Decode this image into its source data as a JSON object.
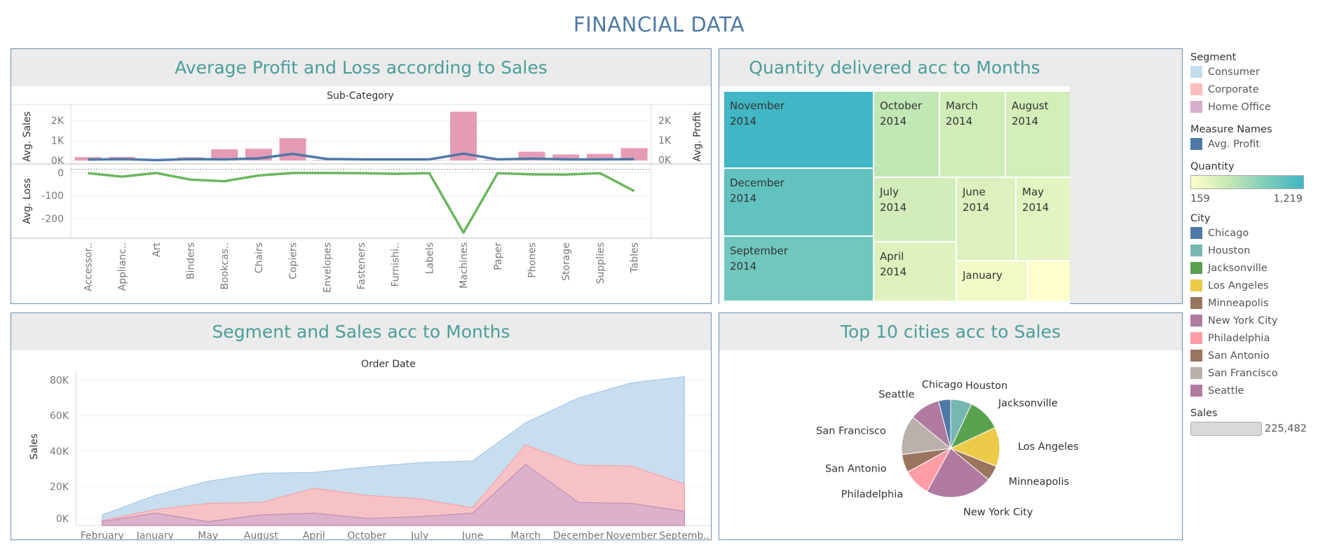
{
  "title": "FINANCIAL DATA",
  "colors": {
    "consumer": "#c3dcee",
    "corporate": "#ffbdbd",
    "home_office": "#d7aecb",
    "avg_profit": "#4e79a7",
    "avg_loss": "#6ab85c",
    "bar": "#e69bb5",
    "header_text": "#4a9e9a",
    "title": "#4e79a7"
  },
  "panels": {
    "profit_loss": {
      "title": "Average Profit and Loss according to Sales",
      "header_label": "Sub-Category"
    },
    "treemap": {
      "title": "Quantity delivered acc to Months"
    },
    "segment_sales": {
      "title": "Segment and Sales acc to Months",
      "header_label": "Order Date"
    },
    "top_cities": {
      "title": "Top 10 cities acc to Sales"
    }
  },
  "legend": {
    "segment": {
      "title": "Segment",
      "items": [
        "Consumer",
        "Corporate",
        "Home Office"
      ],
      "colors": [
        "#c3dcee",
        "#ffbdbd",
        "#d7aecb"
      ]
    },
    "measure_names": {
      "title": "Measure Names",
      "items": [
        "Avg. Profit"
      ],
      "colors": [
        "#4e79a7"
      ]
    },
    "quantity": {
      "title": "Quantity",
      "min": "159",
      "max": "1,219"
    },
    "city": {
      "title": "City",
      "items": [
        "Chicago",
        "Houston",
        "Jacksonville",
        "Los Angeles",
        "Minneapolis",
        "New York City",
        "Philadelphia",
        "San Antonio",
        "San Francisco",
        "Seattle"
      ],
      "colors": [
        "#4e79a7",
        "#76b7b2",
        "#59a14f",
        "#edc948",
        "#9c755f",
        "#b07aa1",
        "#ff9da7",
        "#9c755f",
        "#bab0ac",
        "#b07aa1"
      ]
    },
    "sales": {
      "title": "Sales",
      "value": "225,482"
    }
  },
  "chart_data": [
    {
      "type": "bar",
      "title": "Average Profit and Loss according to Sales",
      "xlabel": "Sub-Category",
      "categories": [
        "Accessor..",
        "Applianc..",
        "Art",
        "Binders",
        "Bookcas..",
        "Chairs",
        "Copiers",
        "Envelopes",
        "Fasteners",
        "Furnishi..",
        "Labels",
        "Machines",
        "Paper",
        "Phones",
        "Storage",
        "Supplies",
        "Tables"
      ],
      "sales_axis": {
        "label": "Avg. Sales",
        "ticks": [
          "2K",
          "1K",
          "0K"
        ],
        "ylim": [
          0,
          2500
        ]
      },
      "profit_axis": {
        "label": "Avg. Profit",
        "ticks": [
          "2K",
          "1K",
          "0K"
        ],
        "ylim": [
          0,
          2500
        ]
      },
      "loss_axis": {
        "label": "Avg. Loss",
        "ticks": [
          "0",
          "-100",
          "-200"
        ],
        "ylim": [
          -280,
          20
        ]
      },
      "series": [
        {
          "name": "Avg. Sales",
          "chart": "bar",
          "values": [
            170,
            180,
            20,
            160,
            560,
            590,
            1120,
            30,
            30,
            50,
            20,
            2450,
            40,
            440,
            300,
            330,
            620
          ]
        },
        {
          "name": "Avg. Profit",
          "chart": "line",
          "values": [
            10,
            30,
            -20,
            30,
            20,
            70,
            300,
            40,
            20,
            20,
            20,
            310,
            20,
            60,
            20,
            20,
            30
          ]
        },
        {
          "name": "Avg. Loss",
          "chart": "line",
          "values": [
            -2,
            -17,
            -1,
            -30,
            -37,
            -12,
            -1,
            -1,
            -2,
            -5,
            -2,
            -262,
            -2,
            -7,
            -8,
            -2,
            -80
          ]
        }
      ]
    },
    {
      "type": "treemap",
      "title": "Quantity delivered acc to Months",
      "cells": [
        {
          "label": [
            "November",
            "2014"
          ],
          "value": 1219
        },
        {
          "label": [
            "December",
            "2014"
          ],
          "value": 1050
        },
        {
          "label": [
            "September",
            "2014"
          ],
          "value": 980
        },
        {
          "label": [
            "October",
            "2014"
          ],
          "value": 560
        },
        {
          "label": [
            "March",
            "2014"
          ],
          "value": 470
        },
        {
          "label": [
            "August",
            "2014"
          ],
          "value": 450
        },
        {
          "label": [
            "July",
            "2014"
          ],
          "value": 460
        },
        {
          "label": [
            "June",
            "2014"
          ],
          "value": 390
        },
        {
          "label": [
            "May",
            "2014"
          ],
          "value": 350
        },
        {
          "label": [
            "April",
            "2014"
          ],
          "value": 380
        },
        {
          "label": [
            "January"
          ],
          "value": 250
        },
        {
          "label": [],
          "value": 159
        }
      ]
    },
    {
      "type": "area",
      "title": "Segment and Sales acc to Months",
      "xlabel": "Order Date",
      "ylabel": "Sales",
      "categories": [
        "February",
        "January",
        "May",
        "August",
        "April",
        "October",
        "July",
        "June",
        "March",
        "December",
        "November",
        "Septemb.."
      ],
      "yticks": [
        "80K",
        "60K",
        "40K",
        "20K",
        "0K"
      ],
      "ylim": [
        0,
        85000
      ],
      "series": [
        {
          "name": "Consumer",
          "values": [
            4000,
            15000,
            23000,
            27500,
            28000,
            31000,
            33500,
            34500,
            56000,
            70000,
            78500,
            82000
          ]
        },
        {
          "name": "Corporate",
          "values": [
            800,
            7000,
            10500,
            11000,
            19000,
            15000,
            13000,
            8000,
            43500,
            32000,
            31500,
            21500
          ]
        },
        {
          "name": "Home Office",
          "values": [
            200,
            5000,
            200,
            4000,
            5000,
            2000,
            3000,
            5000,
            32500,
            11000,
            10500,
            6000
          ]
        }
      ]
    },
    {
      "type": "pie",
      "title": "Top 10 cities acc to Sales",
      "labels": [
        "Houston",
        "Jacksonville",
        "Los Angeles",
        "Minneapolis",
        "New York City",
        "Philadelphia",
        "San Antonio",
        "San Francisco",
        "Seattle",
        "Chicago"
      ],
      "values": [
        7,
        11,
        13,
        5,
        22,
        9,
        6,
        13,
        10,
        4
      ],
      "colors": [
        "#76b7b2",
        "#59a14f",
        "#edc948",
        "#9c755f",
        "#b07aa1",
        "#ff9da7",
        "#9c755f",
        "#bab0ac",
        "#b07aa1",
        "#4e79a7"
      ]
    }
  ]
}
